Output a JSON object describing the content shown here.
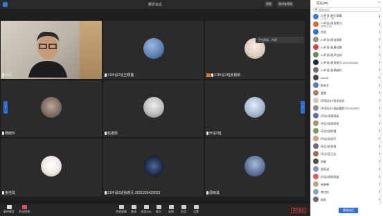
{
  "window": {
    "title": "腾讯会议"
  },
  "topbar": {
    "layout_label": "视图",
    "speaker_label": "演讲者视图"
  },
  "tiles": [
    {
      "name": "作武",
      "kind": "video",
      "color": "#cfc8ba"
    },
    {
      "name": "21环设2班王颖鑫",
      "kind": "avatar",
      "color": "#5b7fb0"
    },
    {
      "name": "21环设2班张扬帆",
      "kind": "avatar",
      "color": "#e9dfd2",
      "host": true
    },
    {
      "name": "杨婉玲",
      "kind": "avatar",
      "color": "#7d6a61"
    },
    {
      "name": "赵嘉熙",
      "kind": "avatar",
      "color": "#bdbdbd"
    },
    {
      "name": "环设2班",
      "kind": "avatar",
      "color": "#9fb3cc"
    },
    {
      "name": "金佳玟",
      "kind": "avatar",
      "color": "#f1ece6"
    },
    {
      "name": "21环设2班张航凡-2021205422623",
      "kind": "avatar",
      "color": "#1d2a44"
    },
    {
      "name": "邵雨溪",
      "kind": "avatar",
      "color": "#5b6f9a"
    }
  ],
  "popup": {
    "text": "正在讲话：作武"
  },
  "toolbar": {
    "items": [
      {
        "label": "解除静音",
        "icon": "mic-muted-icon"
      },
      {
        "label": "开启视频",
        "icon": "video-off-icon"
      },
      {
        "label": "共享屏幕",
        "icon": "share-screen-icon"
      },
      {
        "label": "邀请",
        "icon": "invite-icon"
      },
      {
        "label": "成员(28)",
        "icon": "members-icon"
      },
      {
        "label": "聊天",
        "icon": "chat-icon"
      },
      {
        "label": "录制",
        "icon": "record-icon"
      },
      {
        "label": "应用",
        "icon": "apps-icon"
      },
      {
        "label": "设置",
        "icon": "settings-icon"
      }
    ],
    "end_label": "离开会议"
  },
  "panel": {
    "title": "成员(28)",
    "search_placeholder": "搜索成员",
    "members": [
      {
        "name": "21环设2班王颖鑫",
        "sub": "(主持人、我)",
        "color": "#3a7bd5"
      },
      {
        "name": "21环设2班张航凡",
        "sub": "(联席主持)",
        "color": "#e06b2a"
      },
      {
        "name": "作武",
        "sub": "",
        "color": "#2f6fe0"
      },
      {
        "name": "21环设2班张扬帆",
        "sub": "",
        "color": "#9a8d80"
      },
      {
        "name": "21环设2班黄佳慧",
        "sub": "",
        "color": "#c94a4a"
      },
      {
        "name": "21环设2班尹佳林",
        "sub": "",
        "color": "#6b8a5a"
      },
      {
        "name": "21环设2班张航凡-2021205422",
        "sub": "",
        "color": "#1d2a44"
      },
      {
        "name": "21环设2班杨婉玲",
        "sub": "",
        "color": "#7d6a61"
      },
      {
        "name": "Nuzoll",
        "sub": "",
        "color": "#444444"
      },
      {
        "name": "陈彦文",
        "sub": "",
        "color": "#5f7da6"
      },
      {
        "name": "唐雪",
        "sub": "",
        "color": "#a08466"
      },
      {
        "name": "环境设计2班金佳玟",
        "sub": "",
        "color": "#d7c7b8"
      },
      {
        "name": "环境设计2班赵嘉熙2021205422",
        "sub": "",
        "color": "#8c8c8c"
      },
      {
        "name": "环设2班邵雨溪",
        "sub": "",
        "color": "#5b6f9a"
      },
      {
        "name": "环设2班周思雨",
        "sub": "",
        "color": "#b08f6a"
      },
      {
        "name": "环设2班陈雪",
        "sub": "",
        "color": "#7a9a6a"
      },
      {
        "name": "环设2班吴莎",
        "sub": "",
        "color": "#c8a37a"
      },
      {
        "name": "环设2班刘宸",
        "sub": "",
        "color": "#6a6a8a"
      },
      {
        "name": "环设2班王佳",
        "sub": "",
        "color": "#9e6b4f"
      },
      {
        "name": "李静",
        "sub": "",
        "color": "#4d4d4d"
      },
      {
        "name": "邵雨涵",
        "sub": "",
        "color": "#7b94b8"
      },
      {
        "name": "环设2班陈雨涵",
        "sub": "",
        "color": "#d95f5f"
      },
      {
        "name": "宋彦琳",
        "sub": "",
        "color": "#b7a48f"
      },
      {
        "name": "李佳欣",
        "sub": "",
        "color": "#8aa0b8"
      },
      {
        "name": "邵雨",
        "sub": "",
        "color": "#6b6b6b"
      }
    ],
    "invite_label": "邀请成员"
  }
}
